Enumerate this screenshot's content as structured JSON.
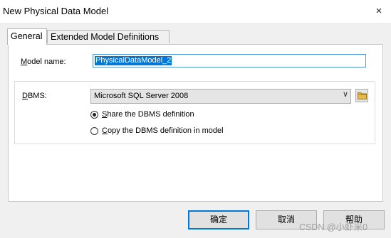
{
  "window": {
    "title": "New Physical Data Model",
    "close_icon": "×"
  },
  "tabs": [
    {
      "label": "General",
      "active": true
    },
    {
      "label": "Extended Model Definitions",
      "active": false
    }
  ],
  "general": {
    "model_name_label_key": "M",
    "model_name_label_rest": "odel name:",
    "model_name_value": "PhysicalDataModel_2",
    "dbms_label_key": "D",
    "dbms_label_rest": "BMS:",
    "dbms_value": "Microsoft SQL Server 2008",
    "dbms_arrow": "∨",
    "share_option": {
      "key": "S",
      "rest": "hare the DBMS definition",
      "selected": true
    },
    "copy_option": {
      "key": "C",
      "rest": "opy the DBMS definition in model",
      "selected": false
    }
  },
  "buttons": {
    "ok": "确定",
    "cancel": "取消",
    "help": "帮助"
  },
  "watermark": "CSDN @小虾米0",
  "colors": {
    "accent": "#0078d7",
    "folder": "#e8b84a"
  }
}
